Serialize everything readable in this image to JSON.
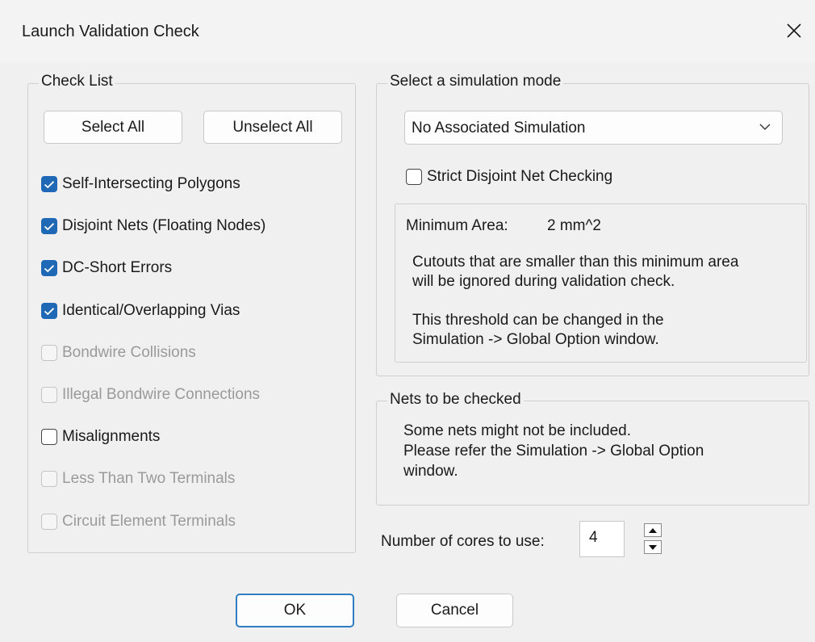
{
  "window": {
    "title": "Launch Validation Check"
  },
  "checklist": {
    "label": "Check List",
    "select_all_label": "Select All",
    "unselect_all_label": "Unselect All",
    "items": [
      {
        "label": "Self-Intersecting Polygons",
        "checked": true,
        "enabled": true
      },
      {
        "label": "Disjoint Nets (Floating Nodes)",
        "checked": true,
        "enabled": true
      },
      {
        "label": "DC-Short Errors",
        "checked": true,
        "enabled": true
      },
      {
        "label": "Identical/Overlapping Vias",
        "checked": true,
        "enabled": true
      },
      {
        "label": "Bondwire Collisions",
        "checked": false,
        "enabled": false
      },
      {
        "label": "Illegal Bondwire Connections",
        "checked": false,
        "enabled": false
      },
      {
        "label": "Misalignments",
        "checked": false,
        "enabled": true
      },
      {
        "label": "Less Than Two Terminals",
        "checked": false,
        "enabled": false
      },
      {
        "label": "Circuit Element Terminals",
        "checked": false,
        "enabled": false
      }
    ]
  },
  "simulation": {
    "label": "Select a simulation mode",
    "selected": "No Associated Simulation",
    "strict_label": "Strict Disjoint Net Checking",
    "strict_checked": false,
    "min_area_label": "Minimum Area:",
    "min_area_value": "2 mm^2",
    "info_line1": "Cutouts that are smaller than this minimum area",
    "info_line2": "will be ignored during validation check.",
    "info_line3": "This threshold can be changed in the",
    "info_line4": "Simulation -> Global Option window."
  },
  "nets": {
    "label": "Nets to be checked",
    "line1": "Some nets might not be included.",
    "line2": "Please refer the Simulation -> Global Option",
    "line3": "window."
  },
  "cores": {
    "label": "Number of cores to use:",
    "value": "4"
  },
  "buttons": {
    "ok": "OK",
    "cancel": "Cancel"
  },
  "colors": {
    "accent": "#1f68b5",
    "focus_border": "#2f7ec3",
    "disabled_text": "#9a9a9a"
  },
  "icons": {
    "close": "close-icon",
    "dropdown": "chevron-down-icon",
    "spin_up": "triangle-up-icon",
    "spin_down": "triangle-down-icon",
    "check": "checkmark-icon"
  }
}
